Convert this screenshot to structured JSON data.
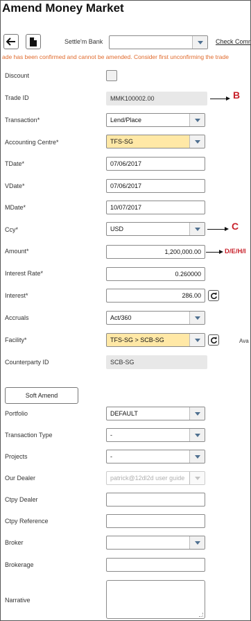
{
  "title": "Amend Money Market",
  "toolbar": {
    "back_icon": "arrow-left-icon",
    "doc_icon": "document-icon",
    "settle_bank_label": "Settle'm Bank",
    "settle_bank_value": "",
    "check_link": "Check Comm"
  },
  "warning": "ade has been confirmed and cannot be amended. Consider first unconfirming the trade",
  "fields": {
    "discount": {
      "label": "Discount",
      "checked": false
    },
    "trade_id": {
      "label": "Trade ID",
      "value": "MMK100002.00"
    },
    "transaction": {
      "label": "Transaction*",
      "value": "Lend/Place"
    },
    "accounting_centre": {
      "label": "Accounting Centre*",
      "value": "TFS-SG"
    },
    "tdate": {
      "label": "TDate*",
      "value": "07/06/2017"
    },
    "vdate": {
      "label": "VDate*",
      "value": "07/06/2017"
    },
    "mdate": {
      "label": "MDate*",
      "value": "10/07/2017"
    },
    "ccy": {
      "label": "Ccy*",
      "value": "USD"
    },
    "amount": {
      "label": "Amount*",
      "value": "1,200,000.00"
    },
    "interest_rate": {
      "label": "Interest Rate*",
      "value": "0.260000"
    },
    "interest": {
      "label": "Interest*",
      "value": "286.00"
    },
    "accruals": {
      "label": "Accruals",
      "value": "Act/360"
    },
    "facility": {
      "label": "Facility*",
      "value": "TFS-SG > SCB-SG",
      "available_label": "Ava"
    },
    "counterparty_id": {
      "label": "Counterparty ID",
      "value": "SCB-SG"
    },
    "portfolio": {
      "label": "Portfolio",
      "value": "DEFAULT"
    },
    "transaction_type": {
      "label": "Transaction Type",
      "value": "-"
    },
    "projects": {
      "label": "Projects",
      "value": "-"
    },
    "our_dealer": {
      "label": "Our Dealer",
      "value": "patrick@12dl2d user guide"
    },
    "ctpy_dealer": {
      "label": "Ctpy Dealer",
      "value": ""
    },
    "ctpy_reference": {
      "label": "Ctpy Reference",
      "value": ""
    },
    "broker": {
      "label": "Broker",
      "value": ""
    },
    "brokerage": {
      "label": "Brokerage",
      "value": ""
    },
    "narrative": {
      "label": "Narrative",
      "value": ""
    }
  },
  "buttons": {
    "soft_amend": "Soft Amend"
  },
  "annotations": {
    "b": "B",
    "c": "C",
    "d": "D/E/H/I"
  },
  "colors": {
    "required_highlight": "#ffe8a6",
    "warning": "#e06a2c",
    "annotation": "#c8202a",
    "readonly_bg": "#e8e8e8"
  }
}
